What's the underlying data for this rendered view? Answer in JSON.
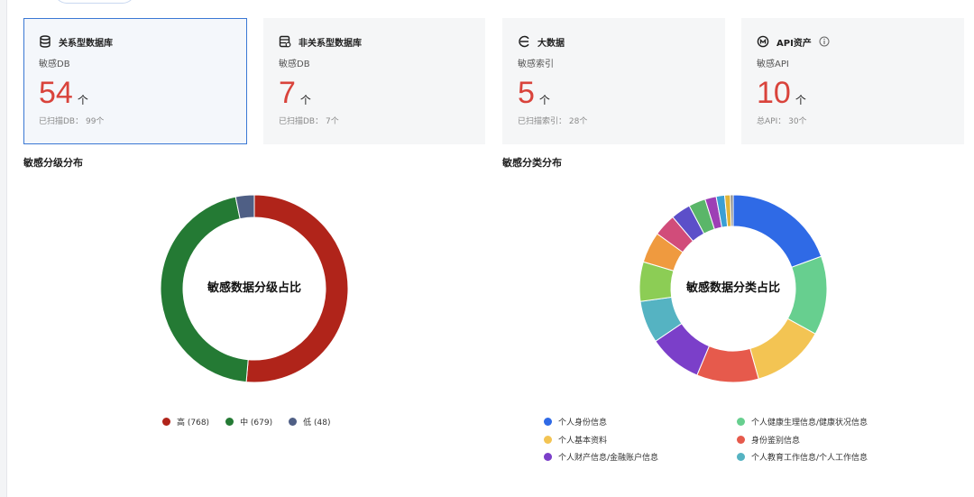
{
  "cards": [
    {
      "title": "关系型数据库",
      "sub": "敏感DB",
      "value": "54",
      "unit": "个",
      "foot": "已扫描DB： 99个",
      "icon": "database-icon"
    },
    {
      "title": "非关系型数据库",
      "sub": "敏感DB",
      "value": "7",
      "unit": "个",
      "foot": "已扫描DB： 7个",
      "icon": "nosql-database-icon"
    },
    {
      "title": "大数据",
      "sub": "敏感索引",
      "value": "5",
      "unit": "个",
      "foot": "已扫描索引： 28个",
      "icon": "bigdata-icon"
    },
    {
      "title": "API资产",
      "sub": "敏感API",
      "value": "10",
      "unit": "个",
      "foot": "总API： 30个",
      "icon": "api-icon"
    }
  ],
  "level_section": {
    "title": "敏感分级分布",
    "center": "敏感数据分级占比",
    "legend": [
      {
        "label": "高 (768)",
        "color": "#b0241a"
      },
      {
        "label": "中 (679)",
        "color": "#247a34"
      },
      {
        "label": "低 (48)",
        "color": "#4f5f85"
      }
    ]
  },
  "category_section": {
    "title": "敏感分类分布",
    "center": "敏感数据分类占比",
    "legend": [
      {
        "label": "个人身份信息",
        "color": "#2f6ae6"
      },
      {
        "label": "个人健康生理信息/健康状况信息",
        "color": "#67cf8f"
      },
      {
        "label": "个人基本资料",
        "color": "#f3c453"
      },
      {
        "label": "身份鉴别信息",
        "color": "#e65a4c"
      },
      {
        "label": "个人财产信息/金融账户信息",
        "color": "#7b3fc9"
      },
      {
        "label": "个人教育工作信息/个人工作信息",
        "color": "#55b3c2"
      }
    ]
  },
  "chart_data": [
    {
      "type": "pie",
      "title": "敏感数据分级占比",
      "categories": [
        "高",
        "中",
        "低"
      ],
      "values": [
        768,
        679,
        48
      ],
      "colors": [
        "#b0241a",
        "#247a34",
        "#4f5f85"
      ]
    },
    {
      "type": "pie",
      "title": "敏感数据分类占比",
      "categories": [
        "个人身份信息",
        "个人健康生理信息/健康状况信息",
        "个人基本资料",
        "身份鉴别信息",
        "个人财产信息/金融账户信息",
        "个人教育工作信息/个人工作信息",
        "",
        "",
        "",
        "",
        "",
        "",
        "",
        "",
        ""
      ],
      "values": [
        20,
        14,
        13,
        11,
        9.5,
        7.5,
        7,
        5.5,
        4,
        3.5,
        3,
        2,
        1.5,
        1,
        0.5
      ],
      "colors": [
        "#2f6ae6",
        "#67cf8f",
        "#f3c453",
        "#e65a4c",
        "#7b3fc9",
        "#55b3c2",
        "#8ccd55",
        "#ef9a3f",
        "#d14c7a",
        "#5c4fc9",
        "#5ab669",
        "#9d3fb5",
        "#3a9fd5",
        "#e0b53a",
        "#888888"
      ]
    }
  ]
}
